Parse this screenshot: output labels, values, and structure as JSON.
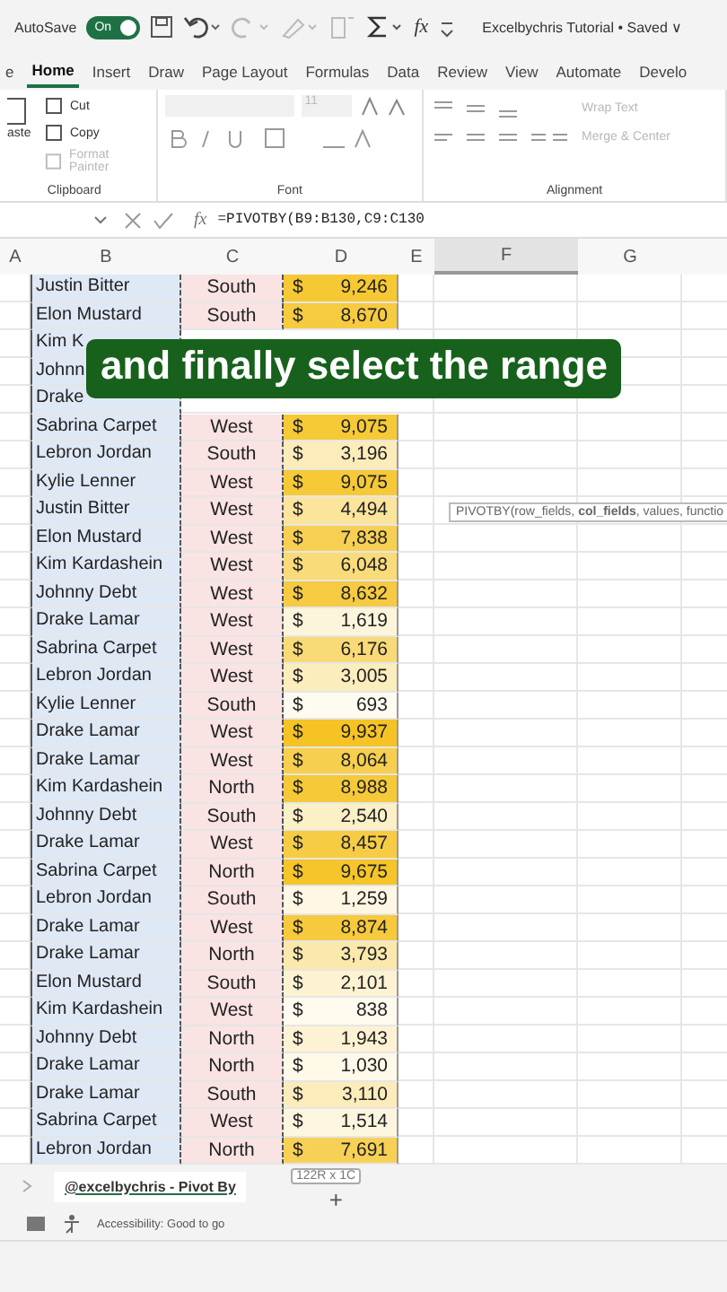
{
  "title_bar": {
    "autosave_label": "AutoSave",
    "autosave_on": true,
    "toggle_text": "On",
    "document_title": "Excelbychris Tutorial • Saved",
    "title_caret": "∨",
    "fx_label": "fx"
  },
  "ribbon_tabs": [
    {
      "label": "e",
      "selected": false
    },
    {
      "label": "Home",
      "selected": true
    },
    {
      "label": "Insert",
      "selected": false
    },
    {
      "label": "Draw",
      "selected": false
    },
    {
      "label": "Page Layout",
      "selected": false
    },
    {
      "label": "Formulas",
      "selected": false
    },
    {
      "label": "Data",
      "selected": false
    },
    {
      "label": "Review",
      "selected": false
    },
    {
      "label": "View",
      "selected": false
    },
    {
      "label": "Automate",
      "selected": false
    },
    {
      "label": "Develo",
      "selected": false
    }
  ],
  "ribbon": {
    "paste_label": "aste",
    "clipboard": [
      {
        "label": "Cut",
        "disabled": false
      },
      {
        "label": "Copy",
        "disabled": false
      },
      {
        "label": "Format Painter",
        "disabled": true
      }
    ],
    "font_size": "11",
    "wrap_text": "Wrap Text",
    "merge_center": "Merge & Center",
    "groups": [
      "Clipboard",
      "Font",
      "Alignment"
    ]
  },
  "formula_bar": {
    "fx": "fx",
    "formula": "=PIVOTBY(B9:B130,C9:C130"
  },
  "columns": [
    {
      "label": "A",
      "selected": false
    },
    {
      "label": "B",
      "selected": false
    },
    {
      "label": "C",
      "selected": false
    },
    {
      "label": "D",
      "selected": false
    },
    {
      "label": "E",
      "selected": false
    },
    {
      "label": "F",
      "selected": true
    },
    {
      "label": "G",
      "selected": false
    }
  ],
  "rows": [
    {
      "name": "Justin Bitter",
      "region": "South",
      "currency": "$",
      "amount": "9,246"
    },
    {
      "name": "Elon Mustard",
      "region": "South",
      "currency": "$",
      "amount": "8,670"
    },
    {
      "name": "Kim K"
    },
    {
      "name": "Johnn"
    },
    {
      "name": "Drake"
    },
    {
      "name": "Sabrina Carpet",
      "region": "West",
      "currency": "$",
      "amount": "9,075"
    },
    {
      "name": "Lebron Jordan",
      "region": "South",
      "currency": "$",
      "amount": "3,196"
    },
    {
      "name": "Kylie Lenner",
      "region": "West",
      "currency": "$",
      "amount": "9,075"
    },
    {
      "name": "Justin Bitter",
      "region": "West",
      "currency": "$",
      "amount": "4,494"
    },
    {
      "name": "Elon Mustard",
      "region": "West",
      "currency": "$",
      "amount": "7,838"
    },
    {
      "name": "Kim Kardashein",
      "region": "West",
      "currency": "$",
      "amount": "6,048"
    },
    {
      "name": "Johnny Debt",
      "region": "West",
      "currency": "$",
      "amount": "8,632"
    },
    {
      "name": "Drake Lamar",
      "region": "West",
      "currency": "$",
      "amount": "1,619"
    },
    {
      "name": "Sabrina Carpet",
      "region": "West",
      "currency": "$",
      "amount": "6,176"
    },
    {
      "name": "Lebron Jordan",
      "region": "West",
      "currency": "$",
      "amount": "3,005"
    },
    {
      "name": "Kylie Lenner",
      "region": "South",
      "currency": "$",
      "amount": "693"
    },
    {
      "name": "Drake Lamar",
      "region": "West",
      "currency": "$",
      "amount": "9,937"
    },
    {
      "name": "Drake Lamar",
      "region": "West",
      "currency": "$",
      "amount": "8,064"
    },
    {
      "name": "Kim Kardashein",
      "region": "North",
      "currency": "$",
      "amount": "8,988"
    },
    {
      "name": "Johnny Debt",
      "region": "South",
      "currency": "$",
      "amount": "2,540"
    },
    {
      "name": "Drake Lamar",
      "region": "West",
      "currency": "$",
      "amount": "8,457"
    },
    {
      "name": "Sabrina Carpet",
      "region": "North",
      "currency": "$",
      "amount": "9,675"
    },
    {
      "name": "Lebron Jordan",
      "region": "South",
      "currency": "$",
      "amount": "1,259"
    },
    {
      "name": "Drake Lamar",
      "region": "West",
      "currency": "$",
      "amount": "8,874"
    },
    {
      "name": "Drake Lamar",
      "region": "North",
      "currency": "$",
      "amount": "3,793"
    },
    {
      "name": "Elon Mustard",
      "region": "South",
      "currency": "$",
      "amount": "2,101"
    },
    {
      "name": "Kim Kardashein",
      "region": "West",
      "currency": "$",
      "amount": "838"
    },
    {
      "name": "Johnny Debt",
      "region": "North",
      "currency": "$",
      "amount": "1,943"
    },
    {
      "name": "Drake Lamar",
      "region": "North",
      "currency": "$",
      "amount": "1,030"
    },
    {
      "name": "Drake Lamar",
      "region": "South",
      "currency": "$",
      "amount": "3,110"
    },
    {
      "name": "Sabrina Carpet",
      "region": "West",
      "currency": "$",
      "amount": "1,514"
    },
    {
      "name": "Lebron Jordan",
      "region": "North",
      "currency": "$",
      "amount": "7,691"
    }
  ],
  "tooltip": "PIVOTBY(row_fields, **col_fields**, values, functio",
  "caption": "and finally select the range",
  "selection_size": "122R x 1C",
  "sheet_tabs": [
    {
      "label": "@excelbychris - Pivot By",
      "selected": true
    }
  ],
  "add_sheet": "+",
  "status": "Accessibility: Good to go"
}
